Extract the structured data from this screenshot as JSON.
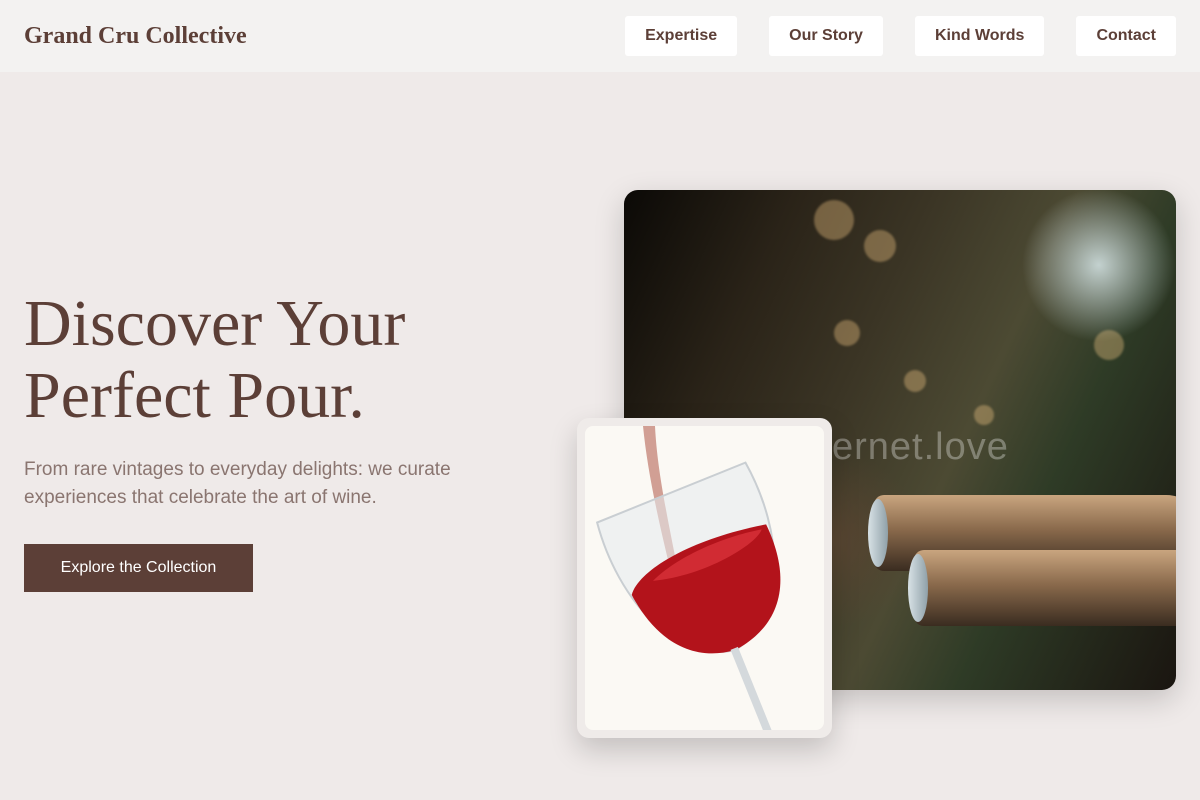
{
  "header": {
    "brand": "Grand Cru Collective",
    "nav": [
      {
        "label": "Expertise"
      },
      {
        "label": "Our Story"
      },
      {
        "label": "Kind Words"
      },
      {
        "label": "Contact"
      }
    ]
  },
  "hero": {
    "title_line1": "Discover Your",
    "title_line2": "Perfect Pour.",
    "subtitle": "From rare vintages to everyday delights: we curate experiences that celebrate the art of wine.",
    "cta_label": "Explore the Collection"
  },
  "media": {
    "main_image": "wine-cellar-bottles-photo",
    "card_image": "red-wine-glass-pour-photo",
    "watermark": "ernet.love"
  },
  "colors": {
    "brand": "#5c3f37",
    "page_bg": "#efeae9",
    "header_bg": "#f3f2f1",
    "muted_text": "#8a7570"
  }
}
